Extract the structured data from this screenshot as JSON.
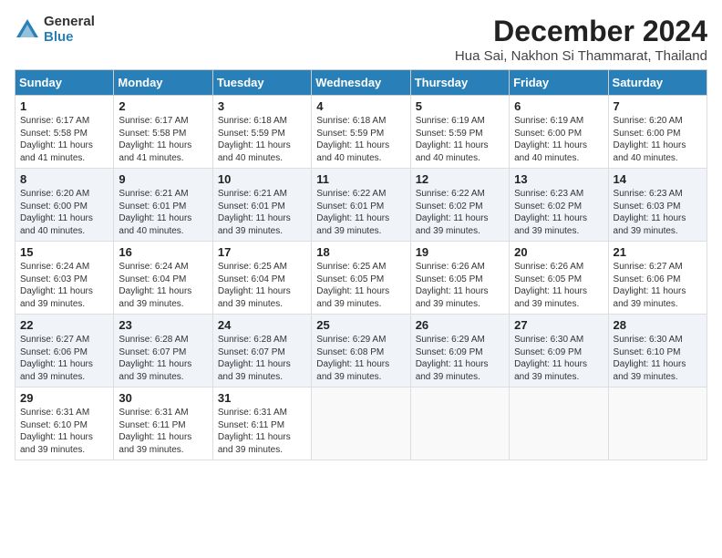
{
  "logo": {
    "general": "General",
    "blue": "Blue"
  },
  "title": "December 2024",
  "location": "Hua Sai, Nakhon Si Thammarat, Thailand",
  "days_of_week": [
    "Sunday",
    "Monday",
    "Tuesday",
    "Wednesday",
    "Thursday",
    "Friday",
    "Saturday"
  ],
  "weeks": [
    [
      {
        "day": 1,
        "sunrise": "6:17 AM",
        "sunset": "5:58 PM",
        "daylight": "11 hours and 41 minutes."
      },
      {
        "day": 2,
        "sunrise": "6:17 AM",
        "sunset": "5:58 PM",
        "daylight": "11 hours and 41 minutes."
      },
      {
        "day": 3,
        "sunrise": "6:18 AM",
        "sunset": "5:59 PM",
        "daylight": "11 hours and 40 minutes."
      },
      {
        "day": 4,
        "sunrise": "6:18 AM",
        "sunset": "5:59 PM",
        "daylight": "11 hours and 40 minutes."
      },
      {
        "day": 5,
        "sunrise": "6:19 AM",
        "sunset": "5:59 PM",
        "daylight": "11 hours and 40 minutes."
      },
      {
        "day": 6,
        "sunrise": "6:19 AM",
        "sunset": "6:00 PM",
        "daylight": "11 hours and 40 minutes."
      },
      {
        "day": 7,
        "sunrise": "6:20 AM",
        "sunset": "6:00 PM",
        "daylight": "11 hours and 40 minutes."
      }
    ],
    [
      {
        "day": 8,
        "sunrise": "6:20 AM",
        "sunset": "6:00 PM",
        "daylight": "11 hours and 40 minutes."
      },
      {
        "day": 9,
        "sunrise": "6:21 AM",
        "sunset": "6:01 PM",
        "daylight": "11 hours and 40 minutes."
      },
      {
        "day": 10,
        "sunrise": "6:21 AM",
        "sunset": "6:01 PM",
        "daylight": "11 hours and 39 minutes."
      },
      {
        "day": 11,
        "sunrise": "6:22 AM",
        "sunset": "6:01 PM",
        "daylight": "11 hours and 39 minutes."
      },
      {
        "day": 12,
        "sunrise": "6:22 AM",
        "sunset": "6:02 PM",
        "daylight": "11 hours and 39 minutes."
      },
      {
        "day": 13,
        "sunrise": "6:23 AM",
        "sunset": "6:02 PM",
        "daylight": "11 hours and 39 minutes."
      },
      {
        "day": 14,
        "sunrise": "6:23 AM",
        "sunset": "6:03 PM",
        "daylight": "11 hours and 39 minutes."
      }
    ],
    [
      {
        "day": 15,
        "sunrise": "6:24 AM",
        "sunset": "6:03 PM",
        "daylight": "11 hours and 39 minutes."
      },
      {
        "day": 16,
        "sunrise": "6:24 AM",
        "sunset": "6:04 PM",
        "daylight": "11 hours and 39 minutes."
      },
      {
        "day": 17,
        "sunrise": "6:25 AM",
        "sunset": "6:04 PM",
        "daylight": "11 hours and 39 minutes."
      },
      {
        "day": 18,
        "sunrise": "6:25 AM",
        "sunset": "6:05 PM",
        "daylight": "11 hours and 39 minutes."
      },
      {
        "day": 19,
        "sunrise": "6:26 AM",
        "sunset": "6:05 PM",
        "daylight": "11 hours and 39 minutes."
      },
      {
        "day": 20,
        "sunrise": "6:26 AM",
        "sunset": "6:05 PM",
        "daylight": "11 hours and 39 minutes."
      },
      {
        "day": 21,
        "sunrise": "6:27 AM",
        "sunset": "6:06 PM",
        "daylight": "11 hours and 39 minutes."
      }
    ],
    [
      {
        "day": 22,
        "sunrise": "6:27 AM",
        "sunset": "6:06 PM",
        "daylight": "11 hours and 39 minutes."
      },
      {
        "day": 23,
        "sunrise": "6:28 AM",
        "sunset": "6:07 PM",
        "daylight": "11 hours and 39 minutes."
      },
      {
        "day": 24,
        "sunrise": "6:28 AM",
        "sunset": "6:07 PM",
        "daylight": "11 hours and 39 minutes."
      },
      {
        "day": 25,
        "sunrise": "6:29 AM",
        "sunset": "6:08 PM",
        "daylight": "11 hours and 39 minutes."
      },
      {
        "day": 26,
        "sunrise": "6:29 AM",
        "sunset": "6:09 PM",
        "daylight": "11 hours and 39 minutes."
      },
      {
        "day": 27,
        "sunrise": "6:30 AM",
        "sunset": "6:09 PM",
        "daylight": "11 hours and 39 minutes."
      },
      {
        "day": 28,
        "sunrise": "6:30 AM",
        "sunset": "6:10 PM",
        "daylight": "11 hours and 39 minutes."
      }
    ],
    [
      {
        "day": 29,
        "sunrise": "6:31 AM",
        "sunset": "6:10 PM",
        "daylight": "11 hours and 39 minutes."
      },
      {
        "day": 30,
        "sunrise": "6:31 AM",
        "sunset": "6:11 PM",
        "daylight": "11 hours and 39 minutes."
      },
      {
        "day": 31,
        "sunrise": "6:31 AM",
        "sunset": "6:11 PM",
        "daylight": "11 hours and 39 minutes."
      },
      null,
      null,
      null,
      null
    ]
  ],
  "labels": {
    "sunrise": "Sunrise:",
    "sunset": "Sunset:",
    "daylight": "Daylight:"
  }
}
